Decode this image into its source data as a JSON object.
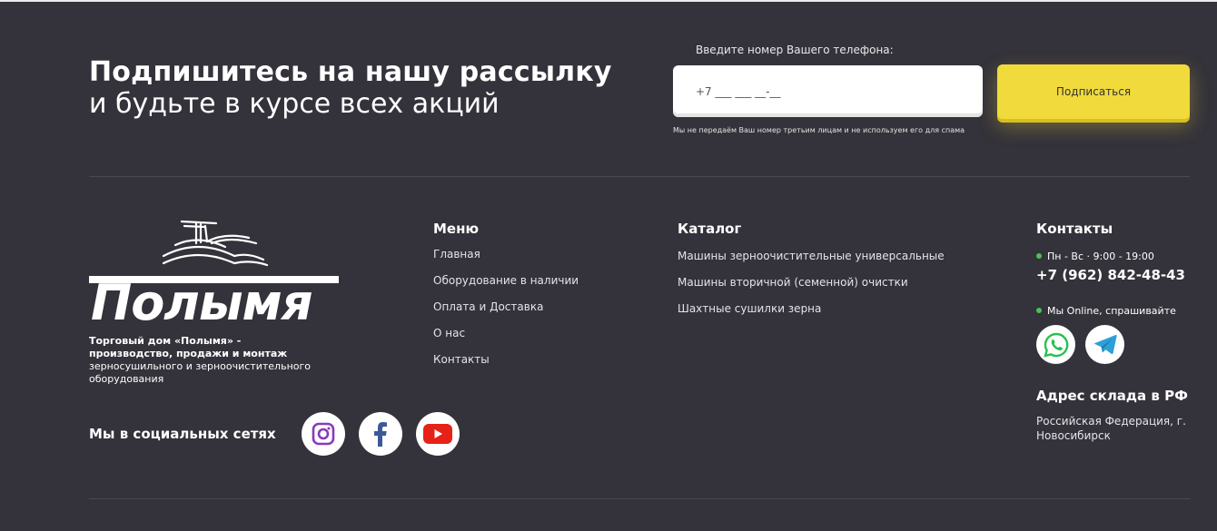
{
  "subscribe": {
    "title": "Подпишитесь на нашу рассылку",
    "subtitle": "и будьте в курсе всех акций",
    "phone_label": "Введите номер Вашего телефона:",
    "phone_placeholder": "+7 ___ ___ __-__",
    "button_label": "Подписаться",
    "privacy_note": "Мы не передаём Ваш номер третьим лицам и не используем его для спама"
  },
  "brand": {
    "logo_text": "Полымя",
    "desc_bold": "Торговый дом «Полымя» - производство, продажи и монтаж",
    "desc_rest": " зерносушильного и зерноочистительного оборудования"
  },
  "social": {
    "title": "Мы в социальных сетях",
    "icons": [
      "instagram-icon",
      "facebook-icon",
      "youtube-icon"
    ]
  },
  "menu": {
    "title": "Меню",
    "items": [
      "Главная",
      "Оборудование в наличии",
      "Оплата и Доставка",
      "О нас",
      "Контакты"
    ]
  },
  "catalog": {
    "title": "Каталог",
    "items": [
      "Машины зерноочистительные универсальные",
      "Машины вторичной (семенной) очистки",
      "Шахтные сушилки зерна"
    ]
  },
  "contacts": {
    "title": "Контакты",
    "hours": "Пн - Вс · 9:00 - 19:00",
    "phone": "+7 (962) 842-48-43",
    "online": "Мы Online, спрашивайте",
    "messengers": [
      "whatsapp-icon",
      "telegram-icon"
    ],
    "warehouse_title": "Адрес склада в РФ",
    "warehouse_address": "Российская Федерация, г. Новосибирск"
  },
  "colors": {
    "background": "#34323a",
    "accent_yellow": "#f1da3c",
    "online_dot": "#4bc15a"
  }
}
